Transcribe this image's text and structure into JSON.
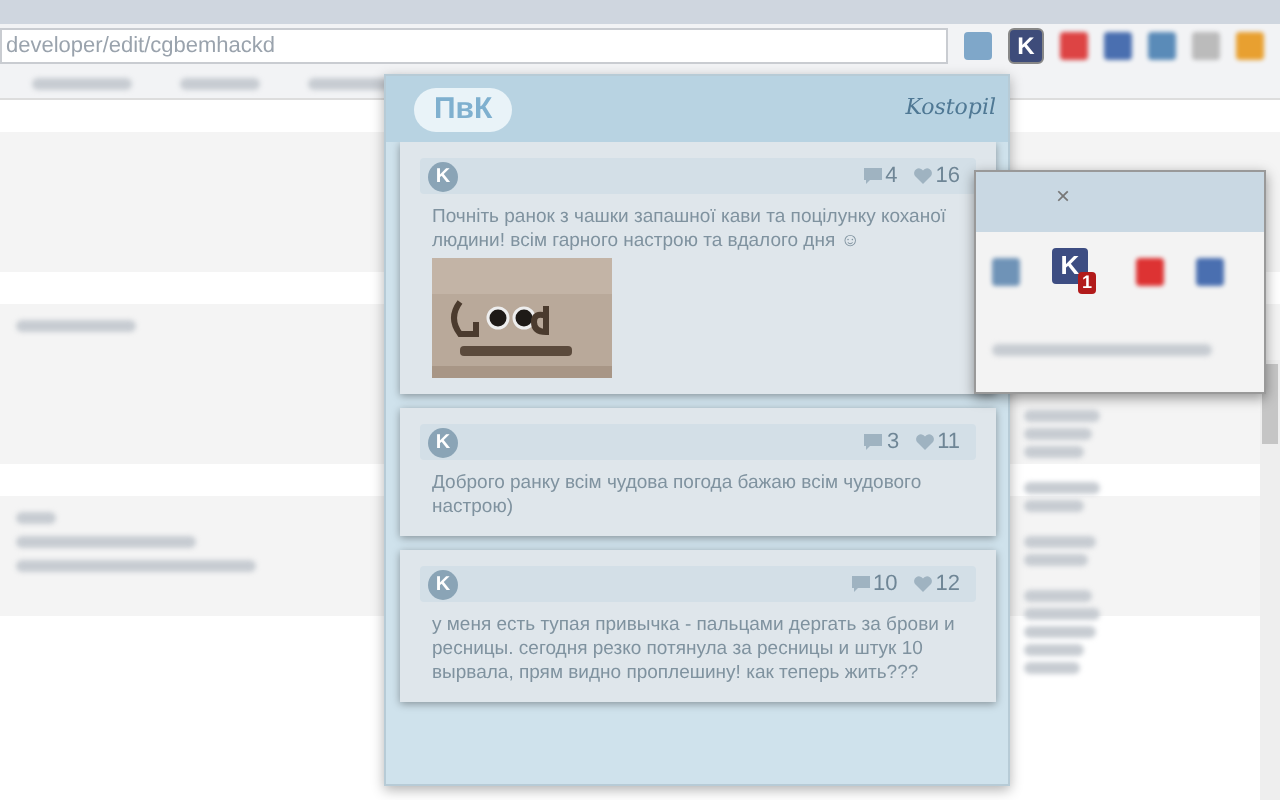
{
  "browser": {
    "url": "developer/edit/cgbemhackd",
    "extension_letter": "K"
  },
  "popup": {
    "logo": "ПвК",
    "town": "Kostopil",
    "posts": [
      {
        "avatar": "K",
        "comments": "4",
        "likes": "16",
        "text": "Почніть ранок з чашки запашної кави та поцілунку коханої людини! всім гарного настрою та вдалого дня ☺"
      },
      {
        "avatar": "K",
        "comments": "3",
        "likes": "11",
        "text": "Доброго ранку всім чудова погода бажаю всім чудового настрою)"
      },
      {
        "avatar": "K",
        "comments": "10",
        "likes": "12",
        "text": "у меня есть тупая привычка - пальцами дергать за брови и ресницы. сегодня резко потянула за ресницы и штук 10 вырвала, прям видно проплешину! как теперь жить???"
      }
    ]
  },
  "hint": {
    "close": "×",
    "letter": "K",
    "badge": "1"
  }
}
